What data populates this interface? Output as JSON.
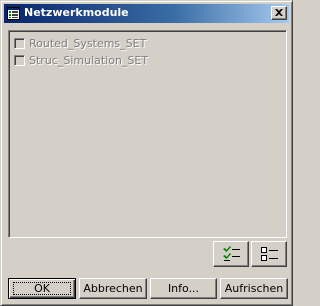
{
  "window": {
    "title": "Netzwerkmodule",
    "close_icon": "close-icon"
  },
  "list": {
    "items": [
      {
        "label": "Routed_Systems_SET",
        "checked": false,
        "enabled": false
      },
      {
        "label": "Struc_Simulation_SET",
        "checked": false,
        "enabled": false
      }
    ]
  },
  "tools": {
    "select_all_icon": "check-all-icon",
    "deselect_all_icon": "uncheck-all-icon"
  },
  "buttons": {
    "ok": "OK",
    "cancel": "Abbrechen",
    "info": "Info...",
    "refresh": "Aufrischen"
  },
  "colors": {
    "title_bar_start": "#08246b",
    "title_bar_end": "#a6caf0",
    "face": "#d4d0c8",
    "disabled_text": "#808080"
  }
}
